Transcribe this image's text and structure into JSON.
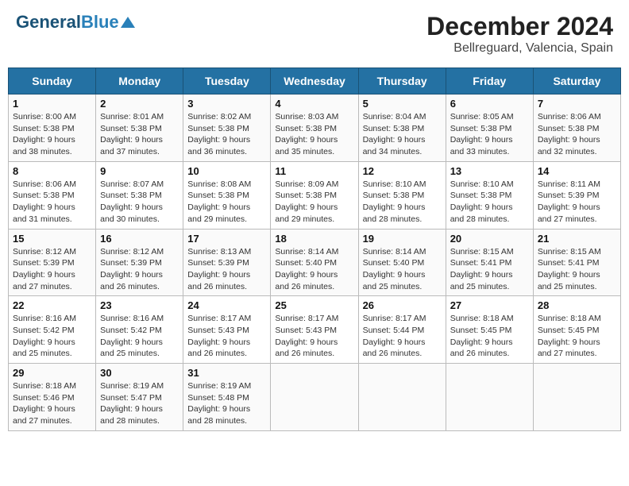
{
  "header": {
    "logo_line1": "General",
    "logo_line2": "Blue",
    "title": "December 2024",
    "subtitle": "Bellreguard, Valencia, Spain"
  },
  "weekdays": [
    "Sunday",
    "Monday",
    "Tuesday",
    "Wednesday",
    "Thursday",
    "Friday",
    "Saturday"
  ],
  "weeks": [
    [
      {
        "day": "1",
        "sunrise": "8:00 AM",
        "sunset": "5:38 PM",
        "daylight": "9 hours and 38 minutes."
      },
      {
        "day": "2",
        "sunrise": "8:01 AM",
        "sunset": "5:38 PM",
        "daylight": "9 hours and 37 minutes."
      },
      {
        "day": "3",
        "sunrise": "8:02 AM",
        "sunset": "5:38 PM",
        "daylight": "9 hours and 36 minutes."
      },
      {
        "day": "4",
        "sunrise": "8:03 AM",
        "sunset": "5:38 PM",
        "daylight": "9 hours and 35 minutes."
      },
      {
        "day": "5",
        "sunrise": "8:04 AM",
        "sunset": "5:38 PM",
        "daylight": "9 hours and 34 minutes."
      },
      {
        "day": "6",
        "sunrise": "8:05 AM",
        "sunset": "5:38 PM",
        "daylight": "9 hours and 33 minutes."
      },
      {
        "day": "7",
        "sunrise": "8:06 AM",
        "sunset": "5:38 PM",
        "daylight": "9 hours and 32 minutes."
      }
    ],
    [
      {
        "day": "8",
        "sunrise": "8:06 AM",
        "sunset": "5:38 PM",
        "daylight": "9 hours and 31 minutes."
      },
      {
        "day": "9",
        "sunrise": "8:07 AM",
        "sunset": "5:38 PM",
        "daylight": "9 hours and 30 minutes."
      },
      {
        "day": "10",
        "sunrise": "8:08 AM",
        "sunset": "5:38 PM",
        "daylight": "9 hours and 29 minutes."
      },
      {
        "day": "11",
        "sunrise": "8:09 AM",
        "sunset": "5:38 PM",
        "daylight": "9 hours and 29 minutes."
      },
      {
        "day": "12",
        "sunrise": "8:10 AM",
        "sunset": "5:38 PM",
        "daylight": "9 hours and 28 minutes."
      },
      {
        "day": "13",
        "sunrise": "8:10 AM",
        "sunset": "5:38 PM",
        "daylight": "9 hours and 28 minutes."
      },
      {
        "day": "14",
        "sunrise": "8:11 AM",
        "sunset": "5:39 PM",
        "daylight": "9 hours and 27 minutes."
      }
    ],
    [
      {
        "day": "15",
        "sunrise": "8:12 AM",
        "sunset": "5:39 PM",
        "daylight": "9 hours and 27 minutes."
      },
      {
        "day": "16",
        "sunrise": "8:12 AM",
        "sunset": "5:39 PM",
        "daylight": "9 hours and 26 minutes."
      },
      {
        "day": "17",
        "sunrise": "8:13 AM",
        "sunset": "5:39 PM",
        "daylight": "9 hours and 26 minutes."
      },
      {
        "day": "18",
        "sunrise": "8:14 AM",
        "sunset": "5:40 PM",
        "daylight": "9 hours and 26 minutes."
      },
      {
        "day": "19",
        "sunrise": "8:14 AM",
        "sunset": "5:40 PM",
        "daylight": "9 hours and 25 minutes."
      },
      {
        "day": "20",
        "sunrise": "8:15 AM",
        "sunset": "5:41 PM",
        "daylight": "9 hours and 25 minutes."
      },
      {
        "day": "21",
        "sunrise": "8:15 AM",
        "sunset": "5:41 PM",
        "daylight": "9 hours and 25 minutes."
      }
    ],
    [
      {
        "day": "22",
        "sunrise": "8:16 AM",
        "sunset": "5:42 PM",
        "daylight": "9 hours and 25 minutes."
      },
      {
        "day": "23",
        "sunrise": "8:16 AM",
        "sunset": "5:42 PM",
        "daylight": "9 hours and 25 minutes."
      },
      {
        "day": "24",
        "sunrise": "8:17 AM",
        "sunset": "5:43 PM",
        "daylight": "9 hours and 26 minutes."
      },
      {
        "day": "25",
        "sunrise": "8:17 AM",
        "sunset": "5:43 PM",
        "daylight": "9 hours and 26 minutes."
      },
      {
        "day": "26",
        "sunrise": "8:17 AM",
        "sunset": "5:44 PM",
        "daylight": "9 hours and 26 minutes."
      },
      {
        "day": "27",
        "sunrise": "8:18 AM",
        "sunset": "5:45 PM",
        "daylight": "9 hours and 26 minutes."
      },
      {
        "day": "28",
        "sunrise": "8:18 AM",
        "sunset": "5:45 PM",
        "daylight": "9 hours and 27 minutes."
      }
    ],
    [
      {
        "day": "29",
        "sunrise": "8:18 AM",
        "sunset": "5:46 PM",
        "daylight": "9 hours and 27 minutes."
      },
      {
        "day": "30",
        "sunrise": "8:19 AM",
        "sunset": "5:47 PM",
        "daylight": "9 hours and 28 minutes."
      },
      {
        "day": "31",
        "sunrise": "8:19 AM",
        "sunset": "5:48 PM",
        "daylight": "9 hours and 28 minutes."
      },
      null,
      null,
      null,
      null
    ]
  ]
}
